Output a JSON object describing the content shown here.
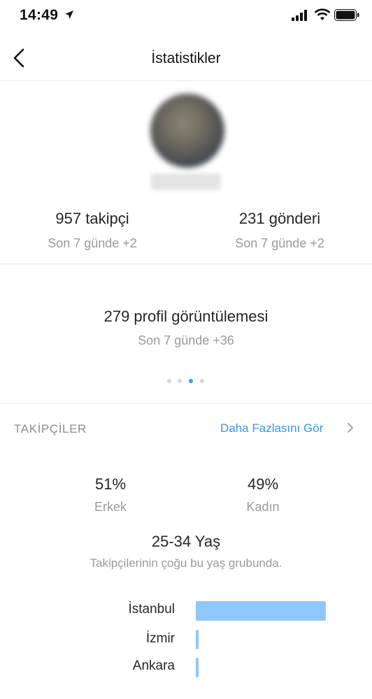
{
  "status_bar": {
    "time": "14:49"
  },
  "nav": {
    "title": "İstatistikler"
  },
  "stats": {
    "followers": {
      "value": "957 takipçi",
      "delta": "Son 7 günde +2"
    },
    "posts": {
      "value": "231 gönderi",
      "delta": "Son 7 günde +2"
    },
    "profile_views": {
      "value": "279 profil görüntülemesi",
      "delta": "Son 7 günde +36"
    }
  },
  "pager": {
    "count": 4,
    "active_index": 2
  },
  "followers_section": {
    "title": "TAKİPÇİLER",
    "see_more": "Daha Fazlasını Gör",
    "gender": [
      {
        "value": "51%",
        "label": "Erkek"
      },
      {
        "value": "49%",
        "label": "Kadın"
      }
    ],
    "age_group": "25-34 Yaş",
    "age_caption": "Takipçilerinin çoğu bu yaş grubunda.",
    "cities": [
      {
        "name": "İstanbul",
        "share": 1.0
      },
      {
        "name": "İzmir",
        "share": 0.02
      },
      {
        "name": "Ankara",
        "share": 0.02
      }
    ]
  },
  "colors": {
    "accent": "#3897f0",
    "bar": "#8ec8fa",
    "muted_text": "#9a9a9a"
  }
}
